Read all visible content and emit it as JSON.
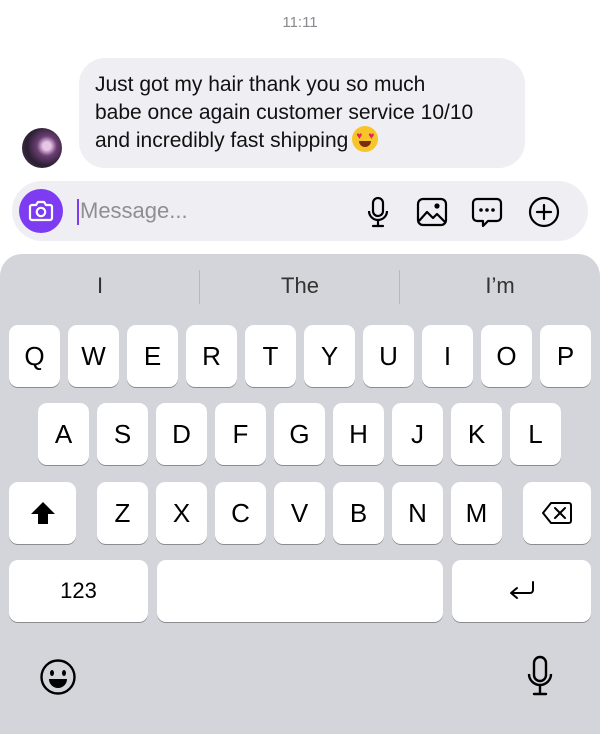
{
  "status": {
    "time": "11:11"
  },
  "message": {
    "line1": "Just got my hair thank you so much",
    "line2": "babe once again customer service 10/10",
    "line3": "and incredibly fast shipping",
    "emoji": "heart-eyes-emoji"
  },
  "composer": {
    "placeholder": "Message...",
    "accent": "#7d3cf2",
    "icons": [
      "camera-icon",
      "microphone-icon",
      "image-icon",
      "sticker-chat-icon",
      "plus-circle-icon"
    ]
  },
  "keyboard": {
    "suggestions": [
      "I",
      "The",
      "I’m"
    ],
    "row1": [
      "Q",
      "W",
      "E",
      "R",
      "T",
      "Y",
      "U",
      "I",
      "O",
      "P"
    ],
    "row2": [
      "A",
      "S",
      "D",
      "F",
      "G",
      "H",
      "J",
      "K",
      "L"
    ],
    "row3": [
      "Z",
      "X",
      "C",
      "V",
      "B",
      "N",
      "M"
    ],
    "numbers_label": "123",
    "icons": [
      "shift-icon",
      "backspace-icon",
      "return-icon",
      "emoji-icon",
      "dictation-mic-icon"
    ]
  }
}
